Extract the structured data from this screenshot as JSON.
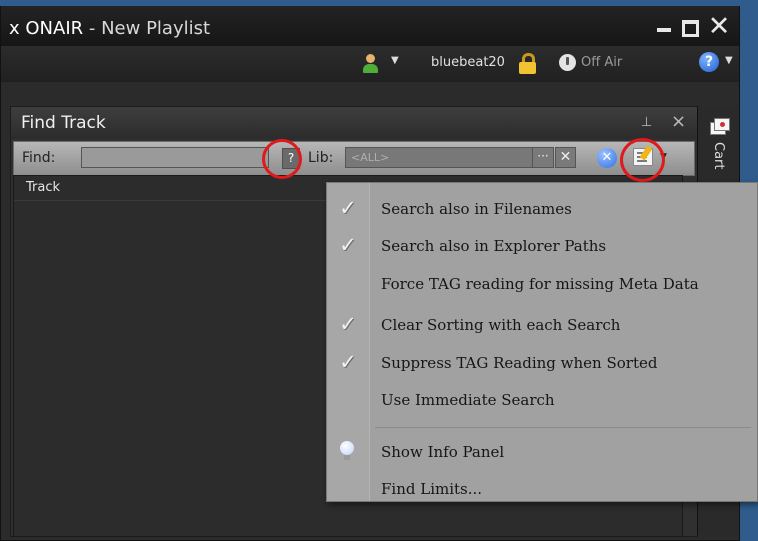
{
  "window": {
    "title_app": "x ONAIR",
    "title_sep": " - ",
    "title_doc": "New Playlist"
  },
  "userbar": {
    "username": "bluebeat20",
    "onair_status": "Off Air",
    "icons": [
      "user-icon",
      "lock-icon",
      "onair-icon",
      "help-icon"
    ]
  },
  "panel": {
    "title": "Find Track",
    "find_label": "Find:",
    "find_value": "",
    "question_label": "?",
    "lib_label": "Lib:",
    "lib_value": "<ALL>",
    "lib_more": "···",
    "lib_clear": "✕",
    "column_header": "Track"
  },
  "side_tab": {
    "label": "Cart"
  },
  "menu": {
    "items": [
      {
        "label": "Search also in Filenames",
        "checked": true
      },
      {
        "label": "Search also in Explorer Paths",
        "checked": true
      },
      {
        "label": "Force TAG reading for missing Meta Data",
        "checked": false
      },
      {
        "label": "Clear Sorting with each Search",
        "checked": true
      },
      {
        "label": "Suppress TAG Reading when Sorted",
        "checked": true
      },
      {
        "label": "Use Immediate Search",
        "checked": false
      },
      {
        "label": "Show Info Panel",
        "checked": false,
        "icon": "lightbulb-icon"
      },
      {
        "label": "Find Limits...",
        "checked": false
      }
    ]
  },
  "colors": {
    "highlight_ring": "#e01a1a",
    "desktop": "#2f5c8c",
    "menu_bg": "#a1a1a1"
  }
}
